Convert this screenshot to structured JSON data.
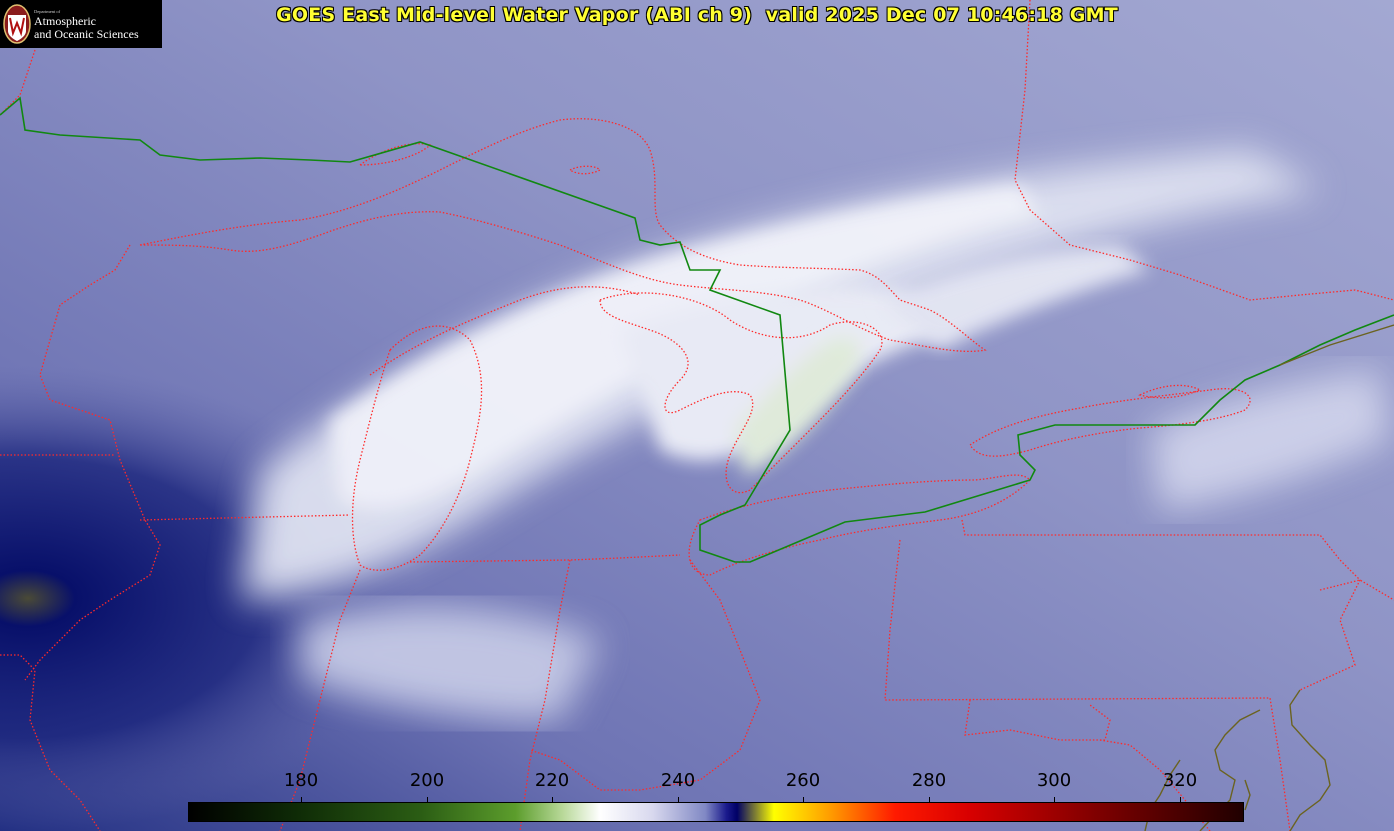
{
  "title": "GOES East Mid-level Water Vapor (ABI ch 9)  valid 2025 Dec 07 10:46:18 GMT",
  "logo": {
    "department_line": "Department of",
    "line1": "Atmospheric",
    "line2": "and Oceanic Sciences",
    "seal_letter": "W"
  },
  "colorbar": {
    "tick_labels": [
      "180",
      "200",
      "220",
      "240",
      "260",
      "280",
      "300",
      "320"
    ],
    "colors": [
      "#000000",
      "#2b5d14",
      "#b9d99a",
      "#ffffff",
      "#8088c4",
      "#000066",
      "#ffff00",
      "#ff9900",
      "#ff1a00",
      "#800000",
      "#200000"
    ]
  },
  "map_colors": {
    "background_moisture": "#7d82b8",
    "dry_dark": "#0d1670",
    "cloud_white": "#f2f3f8",
    "state_borders": "#ff2a2a",
    "international_border": "#118811",
    "coastline_east": "#5a5a1a"
  }
}
